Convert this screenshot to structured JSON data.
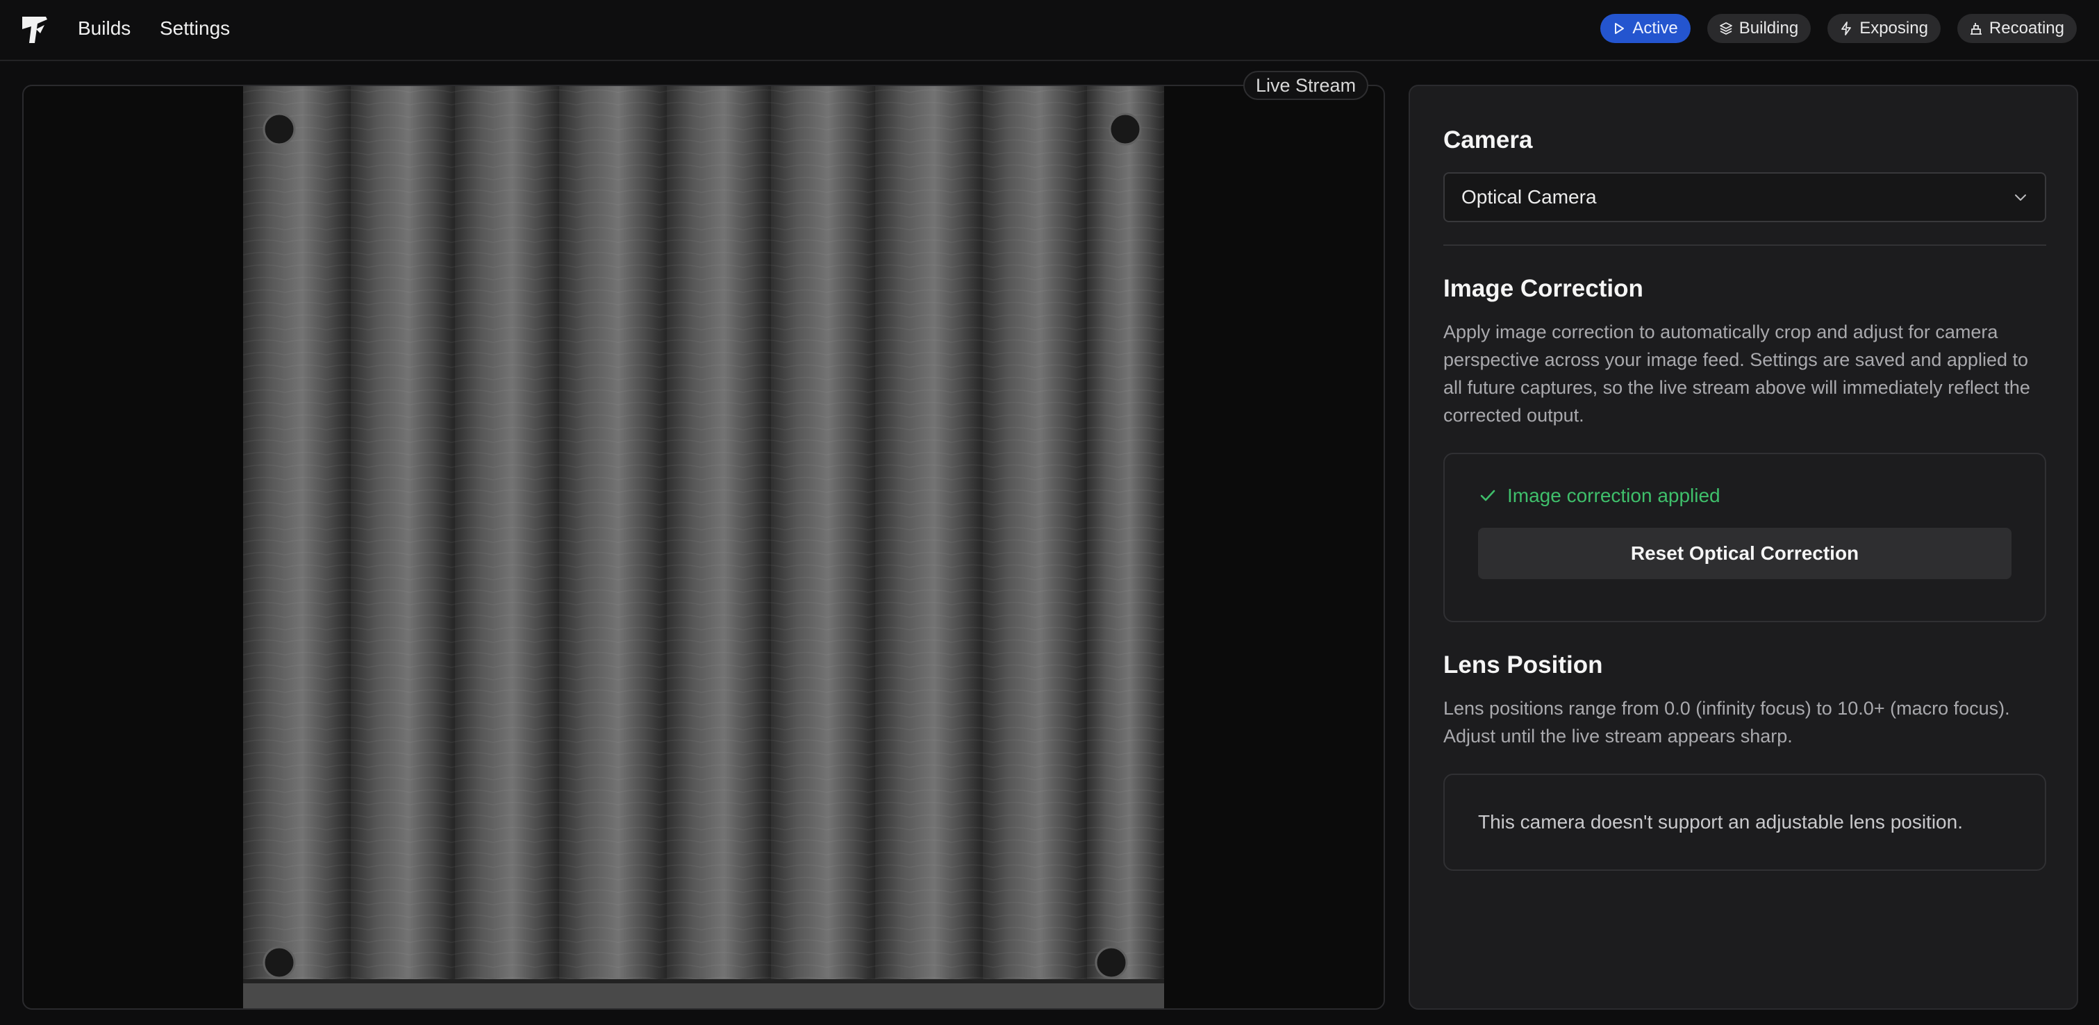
{
  "nav": {
    "builds": "Builds",
    "settings": "Settings"
  },
  "status_pills": [
    {
      "label": "Active",
      "icon": "play-icon",
      "active": true
    },
    {
      "label": "Building",
      "icon": "layers-icon",
      "active": false
    },
    {
      "label": "Exposing",
      "icon": "lightning-icon",
      "active": false
    },
    {
      "label": "Recoating",
      "icon": "recoater-icon",
      "active": false
    }
  ],
  "stream": {
    "label": "Live Stream"
  },
  "camera": {
    "heading": "Camera",
    "selected": "Optical Camera"
  },
  "image_correction": {
    "heading": "Image Correction",
    "description": "Apply image correction to automatically crop and adjust for camera perspective across your image feed. Settings are saved and applied to all future captures, so the live stream above will immediately reflect the corrected output.",
    "status": "Image correction applied",
    "reset_button": "Reset Optical Correction"
  },
  "lens_position": {
    "heading": "Lens Position",
    "description": "Lens positions range from 0.0 (infinity focus) to 10.0+ (macro focus). Adjust until the live stream appears sharp.",
    "notice": "This camera doesn't support an adjustable lens position."
  },
  "colors": {
    "accent": "#2455cf",
    "success": "#3fbf6b",
    "panel": "#1c1c1e",
    "background": "#0d0d0e"
  }
}
